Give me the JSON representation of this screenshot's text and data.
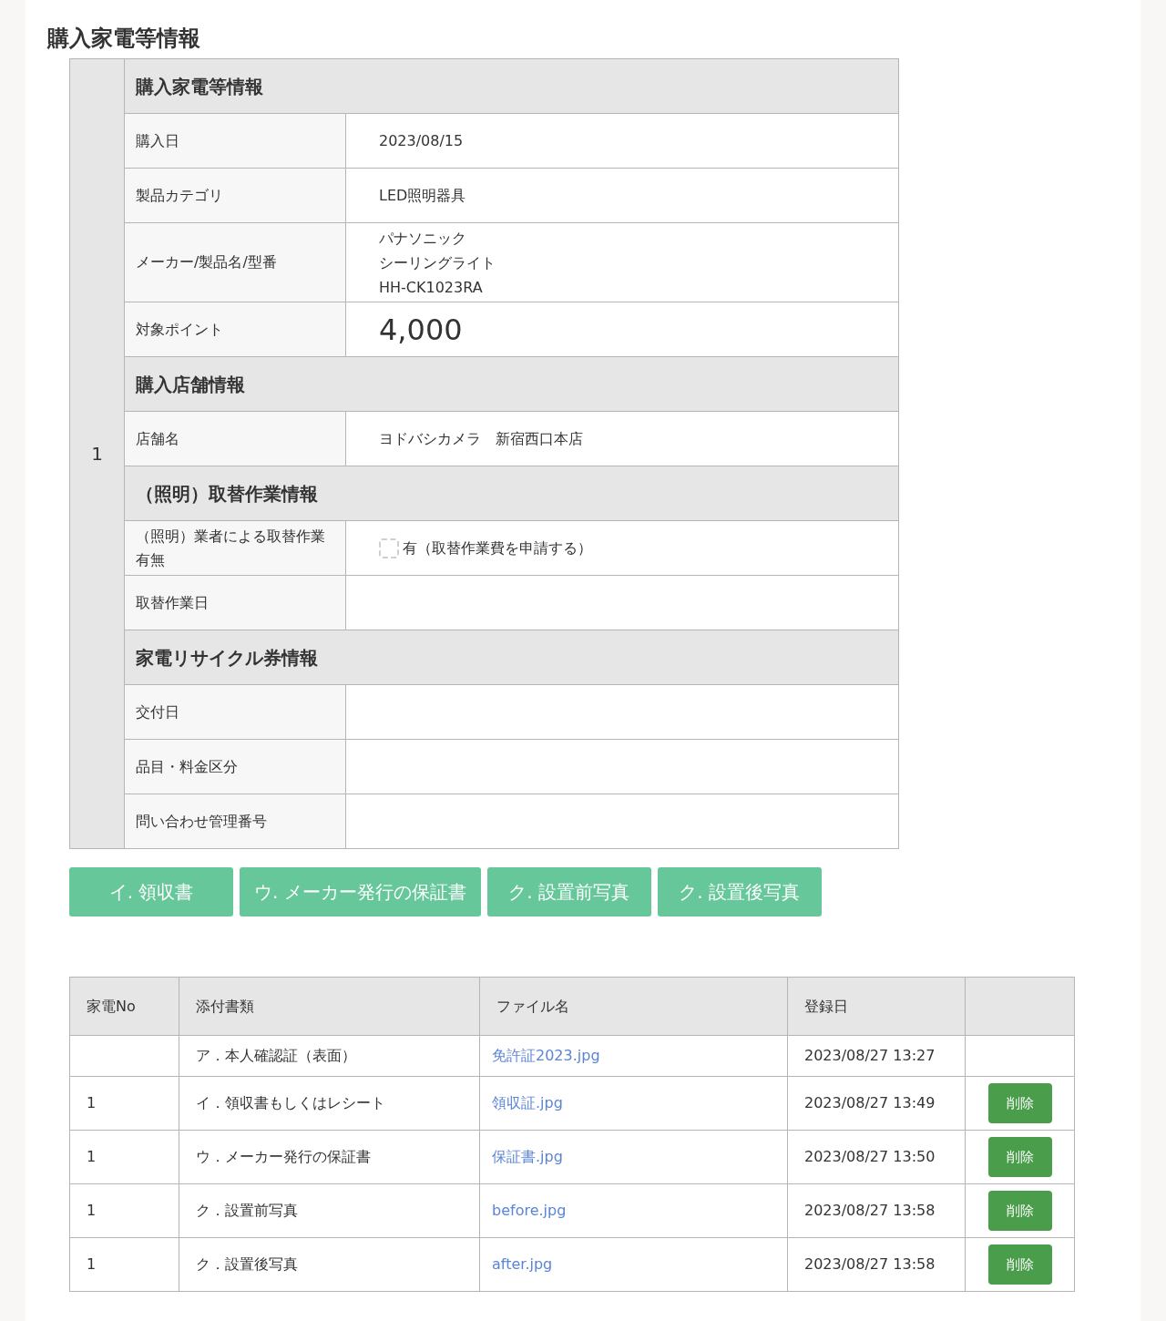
{
  "page_title": "購入家電等情報",
  "item": {
    "number": "1",
    "sections": [
      {
        "title": "購入家電等情報",
        "rows": [
          {
            "kind": "text",
            "label": "購入日",
            "value": "2023/08/15"
          },
          {
            "kind": "text",
            "label": "製品カテゴリ",
            "value": "LED照明器具"
          },
          {
            "kind": "lines",
            "label": "メーカー/製品名/型番",
            "lines": [
              "パナソニック",
              "シーリングライト",
              "HH-CK1023RA"
            ]
          },
          {
            "kind": "points",
            "label": "対象ポイント",
            "value": "4,000"
          }
        ]
      },
      {
        "title": "購入店舗情報",
        "rows": [
          {
            "kind": "text",
            "label": "店舗名",
            "value": "ヨドバシカメラ　新宿西口本店"
          }
        ]
      },
      {
        "title": "（照明）取替作業情報",
        "rows": [
          {
            "kind": "checkbox",
            "label": "（照明）業者による取替作業有無",
            "option": "有（取替作業費を申請する）",
            "checked": false
          },
          {
            "kind": "empty",
            "label": "取替作業日"
          }
        ]
      },
      {
        "title": "家電リサイクル券情報",
        "rows": [
          {
            "kind": "empty",
            "label": "交付日"
          },
          {
            "kind": "empty",
            "label": "品目・料金区分"
          },
          {
            "kind": "empty",
            "label": "問い合わせ管理番号"
          }
        ]
      }
    ]
  },
  "upload_buttons": [
    "イ. 領収書",
    "ウ. メーカー発行の保証書",
    "ク. 設置前写真",
    "ク. 設置後写真"
  ],
  "attachments": {
    "columns": [
      "家電No",
      "添付書類",
      "ファイル名",
      "登録日"
    ],
    "rows": [
      {
        "no": "",
        "document": "ア．本人確認証（表面）",
        "file": "免許証2023.jpg",
        "date": "2023/08/27 13:27"
      },
      {
        "no": "1",
        "document": "イ．領収書もしくはレシート",
        "file": "領収証.jpg",
        "date": "2023/08/27 13:49",
        "delete_label": "削除"
      },
      {
        "no": "1",
        "document": "ウ．メーカー発行の保証書",
        "file": "保証書.jpg",
        "date": "2023/08/27 13:50",
        "delete_label": "削除"
      },
      {
        "no": "1",
        "document": "ク．設置前写真",
        "file": "before.jpg",
        "date": "2023/08/27 13:58",
        "delete_label": "削除"
      },
      {
        "no": "1",
        "document": "ク．設置後写真",
        "file": "after.jpg",
        "date": "2023/08/27 13:58",
        "delete_label": "削除"
      }
    ]
  }
}
